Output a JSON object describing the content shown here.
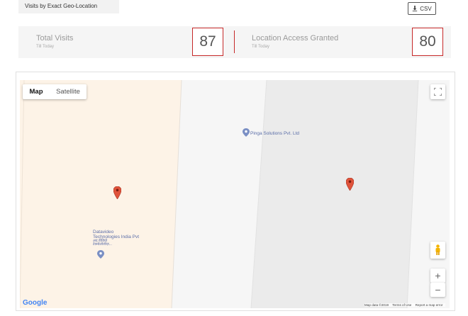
{
  "header": {
    "tab_label": "Visits by Exact Geo-Location",
    "csv_label": "CSV",
    "csv_icon": "download-icon"
  },
  "stats": {
    "total": {
      "title": "Total Visits",
      "subtitle": "Till Today",
      "value": "87"
    },
    "granted": {
      "title": "Location Access Granted",
      "subtitle": "Till Today",
      "value": "80"
    }
  },
  "map": {
    "type_buttons": {
      "map": "Map",
      "satellite": "Satellite"
    },
    "poi_1": "Pinga Solutions Pvt. Ltd",
    "poi_2_line1": "Datavideo",
    "poi_2_line2": "Technologies India Pvt",
    "poi_2_line3": "अद वीडियो",
    "poi_2_line4": "टेक्नोलॉजीज़...",
    "logo": "Google",
    "attribution": {
      "data": "Map data ©2019",
      "terms": "Terms of Use",
      "report": "Report a map error"
    },
    "zoom_in": "+",
    "zoom_out": "−",
    "colors": {
      "left_zone": "#fdf3e7",
      "right_zone": "#ebebeb",
      "marker": "#e0533b"
    }
  }
}
